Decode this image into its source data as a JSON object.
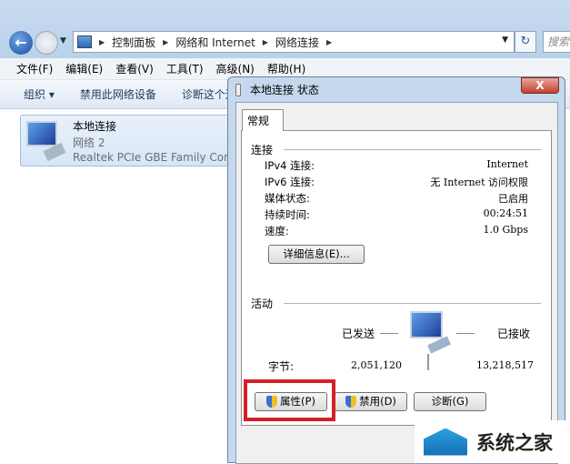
{
  "explorer": {
    "breadcrumb": [
      "控制面板",
      "网络和 Internet",
      "网络连接"
    ],
    "search_placeholder": "搜索",
    "menu": [
      "文件(F)",
      "编辑(E)",
      "查看(V)",
      "工具(T)",
      "高级(N)",
      "帮助(H)"
    ],
    "toolbar": [
      "组织 ▾",
      "禁用此网络设备",
      "诊断这个连接"
    ],
    "connection": {
      "name": "本地连接",
      "network": "网络 2",
      "adapter": "Realtek PCIe GBE Family Controller"
    }
  },
  "dialog": {
    "title": "本地连接 状态",
    "close": "X",
    "tab": "常规",
    "connection_group": "连接",
    "rows": [
      {
        "label": "IPv4 连接:",
        "value": "Internet"
      },
      {
        "label": "IPv6 连接:",
        "value": "无 Internet 访问权限"
      },
      {
        "label": "媒体状态:",
        "value": "已启用"
      },
      {
        "label": "持续时间:",
        "value": "00:24:51"
      },
      {
        "label": "速度:",
        "value": "1.0 Gbps"
      }
    ],
    "details_button": "详细信息(E)...",
    "activity_group": "活动",
    "sent_label": "已发送",
    "received_label": "已接收",
    "bytes_label": "字节:",
    "bytes_sent": "2,051,120",
    "bytes_received": "13,218,517",
    "buttons": {
      "properties": "属性(P)",
      "disable": "禁用(D)",
      "diagnose": "诊断(G)"
    },
    "highlight_color": "#d4202a"
  },
  "watermark": "系统之家"
}
